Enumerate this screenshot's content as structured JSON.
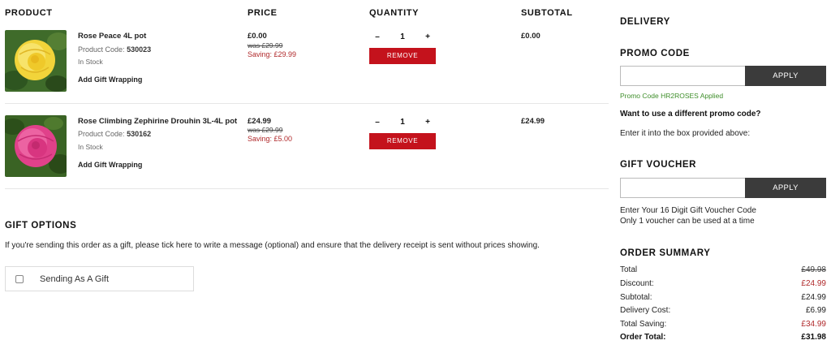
{
  "headers": {
    "product": "PRODUCT",
    "price": "PRICE",
    "quantity": "QUANTITY",
    "subtotal": "SUBTOTAL"
  },
  "items": [
    {
      "name": "Rose Peace 4L pot",
      "code_label": "Product Code:",
      "code": "530023",
      "stock": "In Stock",
      "gift_wrap": "Add Gift Wrapping",
      "price": "£0.00",
      "was": "was £29.99",
      "saving": "Saving: £29.99",
      "minus": "–",
      "qty": "1",
      "plus": "+",
      "remove": "REMOVE",
      "subtotal": "£0.00",
      "flower_color": "#f2d43a"
    },
    {
      "name": "Rose Climbing Zephirine Drouhin 3L-4L pot",
      "code_label": "Product Code:",
      "code": "530162",
      "stock": "In Stock",
      "gift_wrap": "Add Gift Wrapping",
      "price": "£24.99",
      "was": "was £29.99",
      "saving": "Saving: £5.00",
      "minus": "–",
      "qty": "1",
      "plus": "+",
      "remove": "REMOVE",
      "subtotal": "£24.99",
      "flower_color": "#e0418a"
    }
  ],
  "gift": {
    "title": "GIFT OPTIONS",
    "text": "If you're sending this order as a gift, please tick here to write a message (optional) and ensure that the delivery receipt is sent without prices showing.",
    "checkbox_label": "Sending As A Gift"
  },
  "sidebar": {
    "delivery_title": "DELIVERY",
    "promo_title": "PROMO CODE",
    "promo_apply": "APPLY",
    "promo_applied": "Promo Code HR2ROSES Applied",
    "promo_question": "Want to use a different promo code?",
    "promo_hint": "Enter it into the box provided above:",
    "voucher_title": "GIFT VOUCHER",
    "voucher_apply": "APPLY",
    "voucher_hint1": "Enter Your 16 Digit Gift Voucher Code",
    "voucher_hint2": "Only 1 voucher can be used at a time"
  },
  "summary": {
    "title": "ORDER SUMMARY",
    "rows": [
      {
        "label": "Total",
        "value": "£49.98"
      },
      {
        "label": "Discount:",
        "value": "£24.99"
      },
      {
        "label": "Subtotal:",
        "value": "£24.99"
      },
      {
        "label": "Delivery Cost:",
        "value": "£6.99"
      },
      {
        "label": "Total Saving:",
        "value": "£34.99"
      },
      {
        "label": "Order Total:",
        "value": "£31.98"
      }
    ]
  },
  "colors": {
    "remove_button": "#c4121c",
    "apply_button": "#3b3b3b",
    "saving_text": "#b0292b",
    "promo_ok": "#3e8e2a"
  }
}
